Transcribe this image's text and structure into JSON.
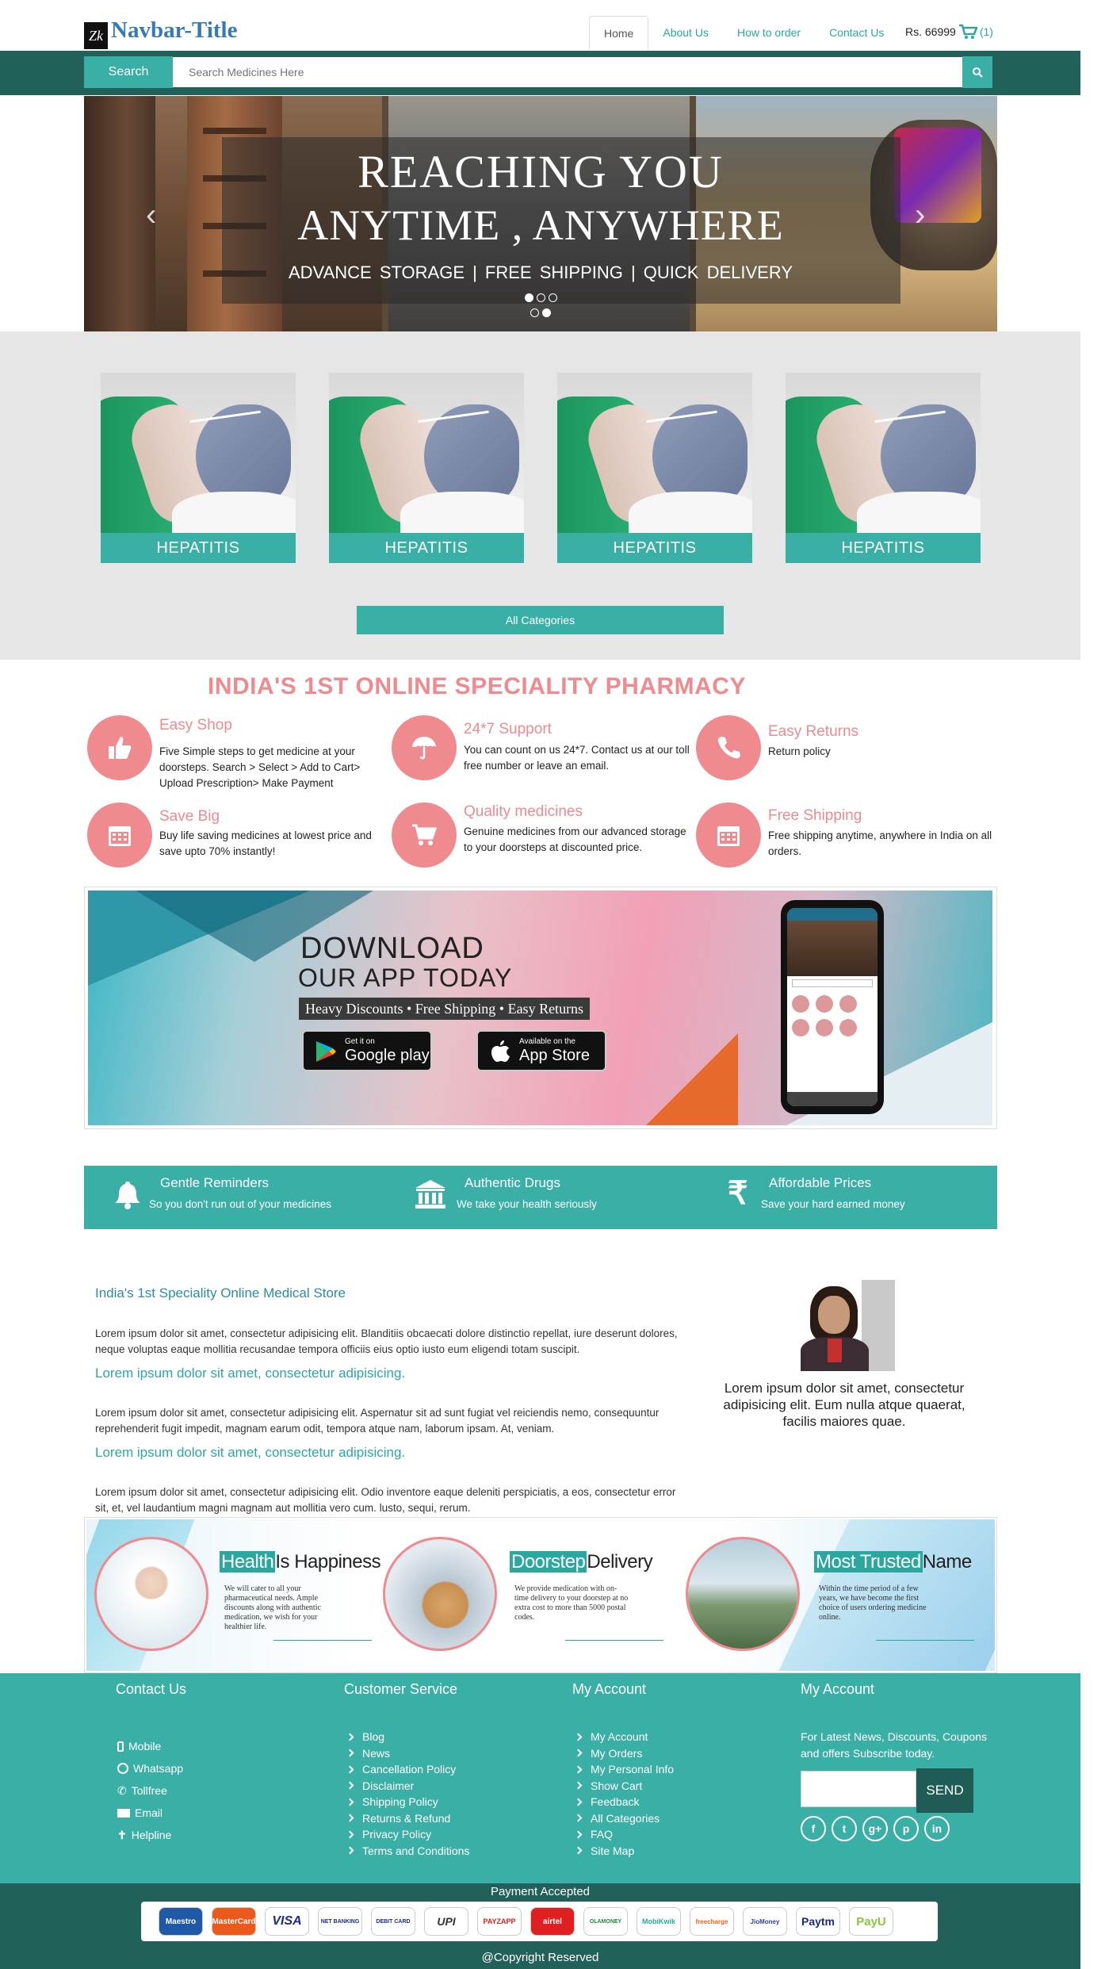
{
  "header": {
    "logo_text": "Zk",
    "brand": "Navbar-Title",
    "nav": [
      "Home",
      "About Us",
      "How to order",
      "Contact Us"
    ],
    "cart_amount": "Rs. 66999",
    "cart_count": "(1)"
  },
  "search": {
    "button_label": "Search",
    "placeholder": "Search Medicines Here"
  },
  "carousel": {
    "line1": "REACHING YOU",
    "line2": "ANYTIME , ANYWHERE",
    "line3": "ADVANCE STORAGE   |   FREE SHIPPING   |   QUICK DELIVERY"
  },
  "categories": {
    "items": [
      "HEPATITIS",
      "HEPATITIS",
      "HEPATITIS",
      "HEPATITIS"
    ],
    "all_label": "All Categories"
  },
  "features": {
    "title": "INDIA'S 1ST ONLINE SPECIALITY PHARMACY",
    "items": [
      {
        "title": "Easy Shop",
        "desc": "Five Simple steps to get medicine at your doorsteps. Search > Select > Add to Cart> Upload Prescription> Make Payment",
        "icon": "thumbs-up-icon"
      },
      {
        "title": "24*7 Support",
        "desc": "You can count on us 24*7. Contact us at our toll free number or leave an email.",
        "icon": "umbrella-icon"
      },
      {
        "title": "Easy Returns",
        "desc": "Return policy",
        "icon": "phone-icon"
      },
      {
        "title": "Save Big",
        "desc": "Buy life saving medicines at lowest price and save upto 70% instantly!",
        "icon": "calendar-icon"
      },
      {
        "title": "Quality medicines",
        "desc": "Genuine medicines from our advanced storage to your doorsteps at discounted price.",
        "icon": "cart-icon"
      },
      {
        "title": "Free Shipping",
        "desc": "Free shipping anytime, anywhere in India on all orders.",
        "icon": "calendar-icon"
      }
    ]
  },
  "app": {
    "line1": "DOWNLOAD",
    "line2": "OUR APP TODAY",
    "tagline": "Heavy Discounts • Free Shipping • Easy Returns",
    "google_small": "Get it on",
    "google_big": "Google play",
    "apple_small": "Available on the",
    "apple_big": "App Store"
  },
  "strip": [
    {
      "title": "Gentle Reminders",
      "desc": "So you don't run out of your medicines",
      "icon": "bell-icon"
    },
    {
      "title": "Authentic Drugs",
      "desc": "We take your health seriously",
      "icon": "bank-icon"
    },
    {
      "title": "Affordable Prices",
      "desc": "Save your hard earned money",
      "icon": "rupee-icon"
    }
  ],
  "about": {
    "title": "India's 1st Speciality Online Medical Store",
    "p1": "Lorem ipsum dolor sit amet, consectetur adipisicing elit. Blanditiis obcaecati dolore distinctio repellat, iure deserunt dolores, neque voluptas eaque mollitia recusandae tempora officiis eius optio iusto eum eligendi totam suscipit.",
    "h2": "Lorem ipsum dolor sit amet, consectetur adipisicing.",
    "p2": "Lorem ipsum dolor sit amet, consectetur adipisicing elit. Aspernatur sit ad sunt fugiat vel reiciendis nemo, consequuntur reprehenderit fugit impedit, magnam earum odit, tempora atque nam, laborum ipsam. At, veniam.",
    "h3": "Lorem ipsum dolor sit amet, consectetur adipisicing.",
    "p3": "Lorem ipsum dolor sit amet, consectetur adipisicing elit. Odio inventore eaque deleniti perspiciatis, a eos, consectetur error sit, et, vel laudantium magni magnam aut mollitia vero cum. lusto, sequi, rerum.",
    "quote": "Lorem ipsum dolor sit amet, consectetur adipisicing elit. Eum nulla atque quaerat, facilis maiores quae."
  },
  "info": [
    {
      "hl": "Health",
      "rest": "Is Happiness",
      "desc": "We will cater to all your pharmaceutical needs. Ample discounts along with authentic medication, we wish for your healthier life."
    },
    {
      "hl": "Doorstep",
      "rest": "Delivery",
      "desc": "We provide medication with on-time delivery to your doorstep at no extra cost to more than 5000 postal codes."
    },
    {
      "hl": "Most Trusted",
      "rest": "Name",
      "desc": "Within the time period of a few years, we have become the first choice of users ordering medicine online."
    }
  ],
  "footer": {
    "contact_title": "Contact Us",
    "contact": [
      "Mobile",
      "Whatsapp",
      "Tollfree",
      "Email",
      "Helpline"
    ],
    "service_title": "Customer Service",
    "service": [
      "Blog",
      "News",
      "Cancellation Policy",
      "Disclaimer",
      "Shipping Policy",
      "Returns & Refund",
      "Privacy Policy",
      "Terms and Conditions"
    ],
    "account_title": "My Account",
    "account": [
      "My Account",
      "My Orders",
      "My Personal Info",
      "Show Cart",
      "Feedback",
      "All Categories",
      "FAQ",
      "Site Map"
    ],
    "news_title": "My Account",
    "news_text": "For Latest News, Discounts, Coupons and offers Subscribe today.",
    "send_label": "SEND",
    "social": [
      "f",
      "t",
      "g+",
      "p",
      "in"
    ]
  },
  "payment": {
    "title": "Payment Accepted",
    "methods": [
      "Maestro",
      "MasterCard",
      "VISA",
      "NET BANKING",
      "DEBIT CARD",
      "UPI",
      "PAYZAPP",
      "airtel",
      "OLAMONEY",
      "MobiKwik",
      "freecharge",
      "JioMoney",
      "Paytm",
      "PayU"
    ],
    "copyright": "@Copyright Reserved"
  },
  "colors": {
    "teal": "#3aafa6",
    "dark_teal": "#22615a",
    "pink": "#ef8a8f",
    "link_blue": "#337ab7"
  }
}
